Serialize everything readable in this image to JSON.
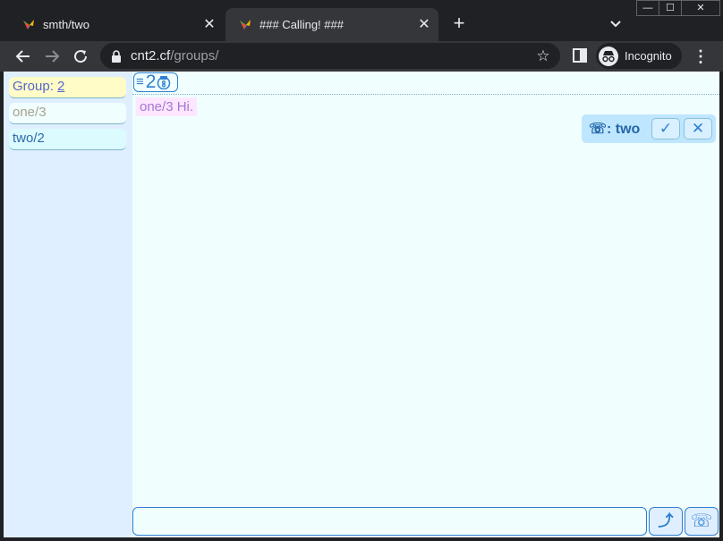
{
  "browser": {
    "tabs": [
      {
        "title": "smth/two",
        "close": "✕"
      },
      {
        "title": "### Calling! ###",
        "close": "✕"
      }
    ],
    "new_tab": "+",
    "window_controls": {
      "minimize": "—",
      "maximize": "☐",
      "close": "✕"
    },
    "url_host": "cnt2.cf",
    "url_path": "/groups/",
    "star": "☆",
    "profile_label": "Incognito",
    "menu": "⋮"
  },
  "sidebar": {
    "group_label": "Group: ",
    "group_number": "2",
    "items": [
      {
        "label": "one/3"
      },
      {
        "label": "two/2"
      }
    ]
  },
  "topbar": {
    "menu_icon": "≡",
    "count": "2"
  },
  "messages": [
    {
      "text": "one/3 Hi."
    }
  ],
  "call": {
    "caller_text": "☏: two",
    "accept": "✓",
    "reject": "✕"
  },
  "composer": {
    "value": "",
    "send": "⤴",
    "call": "☏"
  },
  "colors": {
    "accent": "#2f7fd0",
    "sidebar_bg": "#e0efff",
    "main_bg": "#f0fffe",
    "group_header_bg": "#fffcc8",
    "message_bg": "#ffe6ff",
    "call_box_bg": "#bfe6ff"
  },
  "icons": [
    "app-favicon",
    "close-icon",
    "plus-icon",
    "chevron-down-icon",
    "back-arrow-icon",
    "forward-arrow-icon",
    "reload-icon",
    "lock-icon",
    "star-icon",
    "side-panel-icon",
    "incognito-icon",
    "kebab-menu-icon",
    "hamburger-icon",
    "robot-badge-icon",
    "phone-icon",
    "check-icon",
    "send-icon"
  ]
}
